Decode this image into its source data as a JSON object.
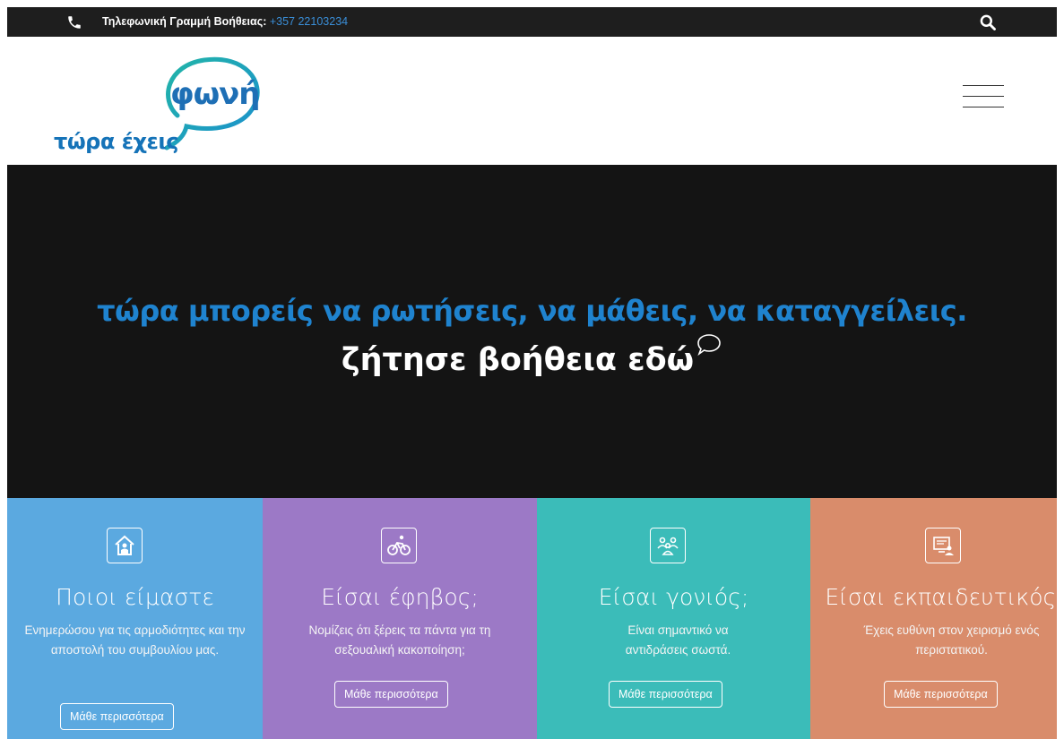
{
  "topbar": {
    "helpline_label": "Τηλεφωνική Γραμμή Βοήθειας:",
    "helpline_number": " +357 22103234",
    "icons": [
      "phone-icon",
      "search-icon"
    ]
  },
  "header": {
    "logo_brand": "φωνή",
    "logo_tagline": "τώρα έχεις",
    "menu_icon": "hamburger-icon"
  },
  "hero": {
    "line1": "τώρα μπορείς να ρωτήσεις, να μάθεις, να καταγγείλεις.",
    "line2": "ζήτησε βοήθεια εδώ"
  },
  "tiles": [
    {
      "icon": "house-icon",
      "color": "#5ba9e0",
      "title": "Ποιοι είμαστε",
      "desc": "Ενημερώσου για τις αρμοδιότητες και την αποστολή του συμβουλίου μας.",
      "button": "Μάθε περισσότερα"
    },
    {
      "icon": "cyclist-icon",
      "color": "#9c79c6",
      "title": "Είσαι έφηβος;",
      "desc": "Νομίζεις ότι ξέρεις τα πάντα για τη σεξουαλική κακοποίηση;",
      "button": "Μάθε περισσότερα"
    },
    {
      "icon": "family-icon",
      "color": "#3bbcb9",
      "title": "Είσαι γονιός;",
      "desc": "Είναι σημαντικό να αντιδράσεις σωστά.",
      "button": "Μάθε περισσότερα"
    },
    {
      "icon": "computer-user-icon",
      "color": "#d98c6b",
      "title": "Είσαι εκπαιδευτικός;",
      "desc": "Έχεις ευθύνη στον χειρισμό ενός περιστατικού.",
      "button": "Μάθε περισσότερα"
    }
  ]
}
